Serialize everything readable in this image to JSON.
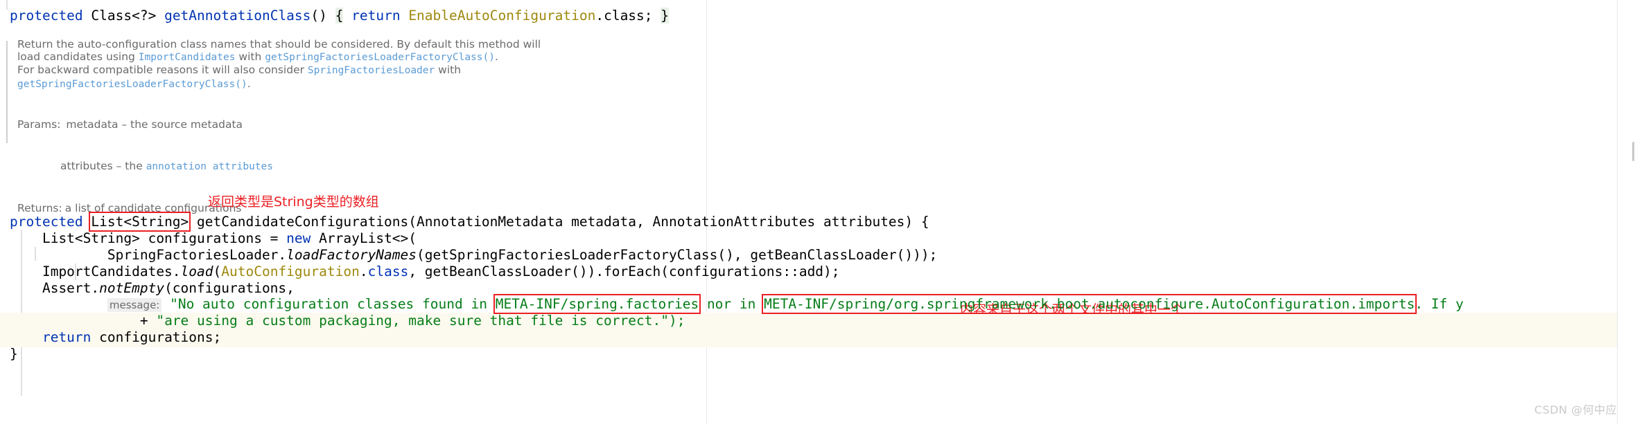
{
  "app": {
    "kind": "code-editor",
    "watermark": "CSDN @何中应"
  },
  "colors": {
    "keyword": "#0033b3",
    "string": "#067d17",
    "annotation_red": "#ec2024",
    "doc_link": "#5b9bd5",
    "doc_text": "#6b6b6b",
    "highlight_line": "#fcfaef",
    "brace_highlight": "#e8f2e8",
    "static_type": "#9e880d"
  },
  "code": {
    "line1": {
      "kw_protected": "protected",
      "type": " Class<?> ",
      "method": "getAnnotationClass",
      "parens": "() ",
      "brace": "{",
      "kw_return": " return ",
      "enum_class": "EnableAutoConfiguration",
      "dot_class": ".class",
      "semi": "; ",
      "close_brace": "}"
    },
    "signature": {
      "kw_protected": "protected ",
      "return_type": "List<String>",
      "method_and_params": " getCandidateConfigurations(AnnotationMetadata metadata, AnnotationAttributes attributes) {"
    },
    "decl_configurations": {
      "lead": "    List<String> configurations = ",
      "kw_new": "new",
      "tail": " ArrayList<>("
    },
    "spring_factories_loader": {
      "klass": "            SpringFactoriesLoader.",
      "method": "loadFactoryNames",
      "tail": "(getSpringFactoriesLoaderFactoryClass(), getBeanClassLoader()));"
    },
    "import_candidates": {
      "klass": "    ImportCandidates.",
      "method": "load",
      "open": "(",
      "type": "AutoConfiguration",
      "dot": ".",
      "kw_class": "class",
      "tail": ", getBeanClassLoader()).forEach(configurations::add);"
    },
    "assert_line": {
      "klass": "    Assert.",
      "method": "notEmpty",
      "tail": "(configurations,"
    },
    "message_line": {
      "indent": "            ",
      "label": "message:",
      "str_part1": " \"No auto configuration classes found in ",
      "path1": "META-INF/spring.factories",
      "str_part2": " nor in ",
      "path2": "META-INF/spring/org.springframework.boot.autoconfigure.AutoConfiguration.imports",
      "str_part3": ". If y"
    },
    "message_line2": {
      "indent": "                ",
      "plus": "+ ",
      "text": "\"are using a custom packaging, make sure that file is correct.\");"
    },
    "return_line": {
      "kw_return": "    return",
      "tail": " configurations;"
    },
    "close_brace_line": "}"
  },
  "doc": {
    "paragraph": [
      {
        "plain_a": "Return the auto-configuration class names that should be considered. By default this method will",
        "plain_b": "load candidates using ",
        "link_b1": "ImportCandidates",
        "plain_b2": " with ",
        "link_b2": "getSpringFactoriesLoaderFactoryClass()",
        "plain_b3": ".",
        "plain_c": "For backward compatible reasons it will also consider ",
        "link_c1": "SpringFactoriesLoader",
        "plain_c2": " with",
        "link_d": "getSpringFactoriesLoaderFactoryClass()",
        "plain_d2": "."
      }
    ],
    "params_label": "Params:",
    "params": [
      {
        "name": "metadata",
        "dash": " – ",
        "desc_plain": "the source metadata",
        "desc_link": ""
      },
      {
        "name": "attributes",
        "dash": " – ",
        "desc_plain": "the ",
        "desc_link": "annotation attributes"
      }
    ],
    "returns_label": "Returns:",
    "returns_value": "a list of candidate configurations"
  },
  "annotations": [
    {
      "id": "return-type-note",
      "text": "返回类型是String类型的数组"
    },
    {
      "id": "source-files-note",
      "text": "内容来自于这个两个文件中的其中一个"
    }
  ]
}
